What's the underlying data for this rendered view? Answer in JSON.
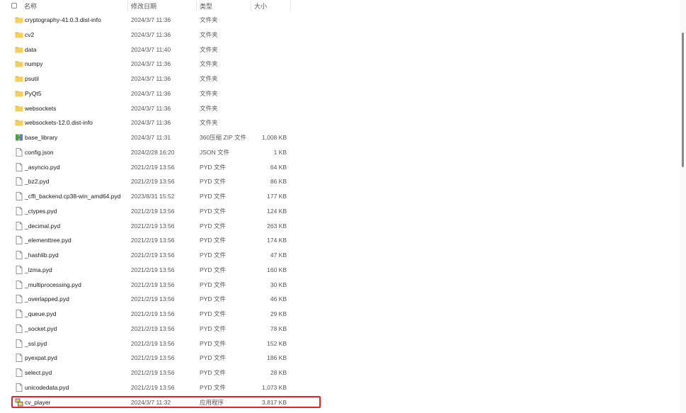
{
  "header": {
    "name": "名称",
    "date": "修改日期",
    "type": "类型",
    "size": "大小",
    "sort_arrow": "^"
  },
  "files": [
    {
      "name": "cryptography-41.0.3.dist-info",
      "date": "2024/3/7 11:36",
      "type": "文件夹",
      "size": "",
      "icon": "folder-icon"
    },
    {
      "name": "cv2",
      "date": "2024/3/7 11:36",
      "type": "文件夹",
      "size": "",
      "icon": "folder-icon"
    },
    {
      "name": "data",
      "date": "2024/3/7 11:40",
      "type": "文件夹",
      "size": "",
      "icon": "folder-icon"
    },
    {
      "name": "numpy",
      "date": "2024/3/7 11:36",
      "type": "文件夹",
      "size": "",
      "icon": "folder-icon"
    },
    {
      "name": "psutil",
      "date": "2024/3/7 11:36",
      "type": "文件夹",
      "size": "",
      "icon": "folder-icon"
    },
    {
      "name": "PyQt5",
      "date": "2024/3/7 11:36",
      "type": "文件夹",
      "size": "",
      "icon": "folder-icon"
    },
    {
      "name": "websockets",
      "date": "2024/3/7 11:36",
      "type": "文件夹",
      "size": "",
      "icon": "folder-icon"
    },
    {
      "name": "websockets-12.0.dist-info",
      "date": "2024/3/7 11:36",
      "type": "文件夹",
      "size": "",
      "icon": "folder-icon"
    },
    {
      "name": "base_library",
      "date": "2024/3/7 11:31",
      "type": "360压缩 ZIP 文件",
      "size": "1,008 KB",
      "icon": "zip-archive-icon"
    },
    {
      "name": "config.json",
      "date": "2024/2/28 16:20",
      "type": "JSON 文件",
      "size": "1 KB",
      "icon": "file-icon"
    },
    {
      "name": "_asyncio.pyd",
      "date": "2021/2/19 13:56",
      "type": "PYD 文件",
      "size": "64 KB",
      "icon": "file-icon"
    },
    {
      "name": "_bz2.pyd",
      "date": "2021/2/19 13:56",
      "type": "PYD 文件",
      "size": "86 KB",
      "icon": "file-icon"
    },
    {
      "name": "_cffi_backend.cp38-win_amd64.pyd",
      "date": "2023/8/31 15:52",
      "type": "PYD 文件",
      "size": "177 KB",
      "icon": "file-icon"
    },
    {
      "name": "_ctypes.pyd",
      "date": "2021/2/19 13:56",
      "type": "PYD 文件",
      "size": "124 KB",
      "icon": "file-icon"
    },
    {
      "name": "_decimal.pyd",
      "date": "2021/2/19 13:56",
      "type": "PYD 文件",
      "size": "263 KB",
      "icon": "file-icon"
    },
    {
      "name": "_elementtree.pyd",
      "date": "2021/2/19 13:56",
      "type": "PYD 文件",
      "size": "174 KB",
      "icon": "file-icon"
    },
    {
      "name": "_hashlib.pyd",
      "date": "2021/2/19 13:56",
      "type": "PYD 文件",
      "size": "47 KB",
      "icon": "file-icon"
    },
    {
      "name": "_lzma.pyd",
      "date": "2021/2/19 13:56",
      "type": "PYD 文件",
      "size": "160 KB",
      "icon": "file-icon"
    },
    {
      "name": "_multiprocessing.pyd",
      "date": "2021/2/19 13:56",
      "type": "PYD 文件",
      "size": "30 KB",
      "icon": "file-icon"
    },
    {
      "name": "_overlapped.pyd",
      "date": "2021/2/19 13:56",
      "type": "PYD 文件",
      "size": "46 KB",
      "icon": "file-icon"
    },
    {
      "name": "_queue.pyd",
      "date": "2021/2/19 13:56",
      "type": "PYD 文件",
      "size": "29 KB",
      "icon": "file-icon"
    },
    {
      "name": "_socket.pyd",
      "date": "2021/2/19 13:56",
      "type": "PYD 文件",
      "size": "78 KB",
      "icon": "file-icon"
    },
    {
      "name": "_ssl.pyd",
      "date": "2021/2/19 13:56",
      "type": "PYD 文件",
      "size": "152 KB",
      "icon": "file-icon"
    },
    {
      "name": "pyexpat.pyd",
      "date": "2021/2/19 13:56",
      "type": "PYD 文件",
      "size": "186 KB",
      "icon": "file-icon"
    },
    {
      "name": "select.pyd",
      "date": "2021/2/19 13:56",
      "type": "PYD 文件",
      "size": "28 KB",
      "icon": "file-icon"
    },
    {
      "name": "unicodedata.pyd",
      "date": "2021/2/19 13:56",
      "type": "PYD 文件",
      "size": "1,073 KB",
      "icon": "file-icon"
    },
    {
      "name": "cv_player",
      "date": "2024/3/7 11:32",
      "type": "应用程序",
      "size": "3,817 KB",
      "icon": "application-icon",
      "highlighted": true
    }
  ],
  "colors": {
    "folder": "#f2c744",
    "highlight_border": "#e0262b",
    "text": "#1a1a1a",
    "secondary_text": "#555555"
  }
}
